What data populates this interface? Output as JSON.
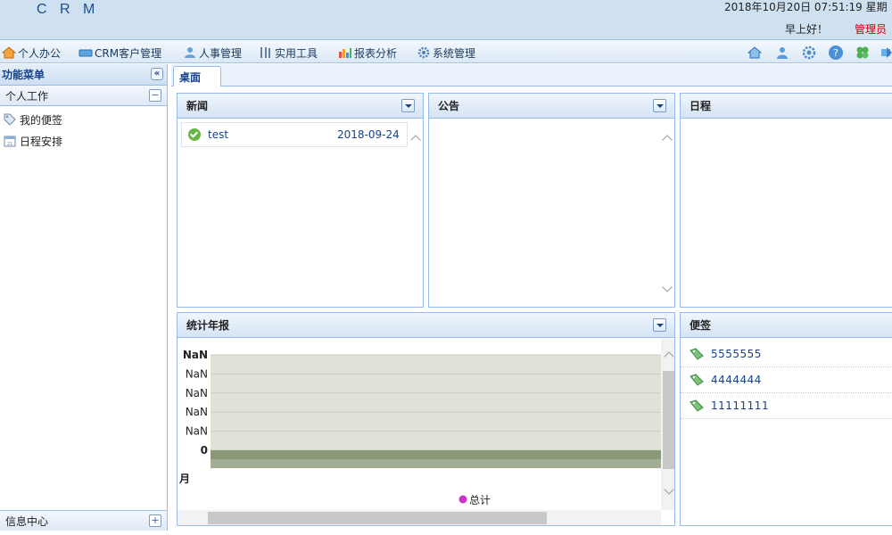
{
  "header": {
    "logo": "C R M",
    "datetime": "2018年10月20日 07:51:19 星期",
    "greeting": "早上好！",
    "user": "管理员"
  },
  "menu": [
    {
      "label": "个人办公",
      "icon": "home-icon"
    },
    {
      "label": "CRM客户管理",
      "icon": "card-icon"
    },
    {
      "label": "人事管理",
      "icon": "person-icon"
    },
    {
      "label": "实用工具",
      "icon": "tools-icon"
    },
    {
      "label": "报表分析",
      "icon": "chart-icon"
    },
    {
      "label": "系统管理",
      "icon": "gear-icon"
    }
  ],
  "toolbar_icons": [
    "home-icon",
    "user-icon",
    "settings-icon",
    "help-icon",
    "plugin-icon",
    "exit-icon"
  ],
  "sidebar": {
    "title": "功能菜单",
    "section": "个人工作",
    "items": [
      {
        "label": "我的便签",
        "icon": "tag-icon"
      },
      {
        "label": "日程安排",
        "icon": "calendar-icon"
      }
    ],
    "footer": "信息中心"
  },
  "tabs": [
    {
      "label": "桌面"
    }
  ],
  "portlets": {
    "news": {
      "title": "新闻",
      "rows": [
        {
          "title": "test",
          "date": "2018-09-24"
        }
      ]
    },
    "notice": {
      "title": "公告"
    },
    "schedule": {
      "title": "日程"
    },
    "annual_report": {
      "title": "统计年报"
    },
    "notes": {
      "title": "便签",
      "items": [
        "5555555",
        "4444444",
        "11111111"
      ]
    }
  },
  "chart_data": {
    "type": "area",
    "y_tick_labels": [
      "NaN",
      "NaN",
      "NaN",
      "NaN",
      "NaN",
      "0"
    ],
    "x_axis_label": "月",
    "series": [
      {
        "name": "总计",
        "color": "#cc33cc",
        "values": [
          0
        ]
      }
    ],
    "colors": {
      "plot_bg": "#dfe3d7",
      "baseline": "#8a9878"
    }
  }
}
